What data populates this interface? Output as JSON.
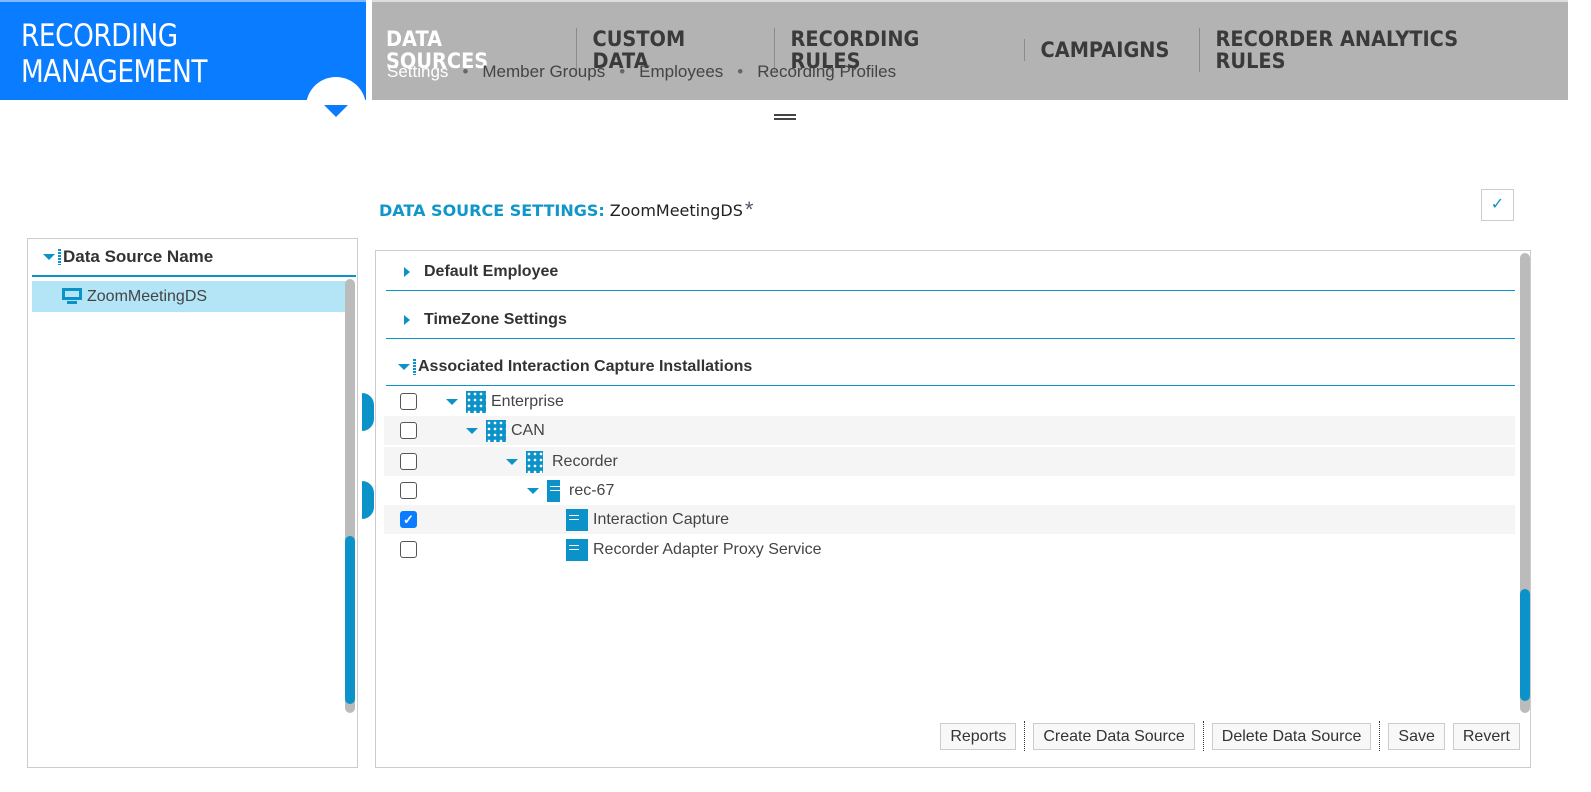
{
  "header": {
    "app_title": "RECORDING MANAGEMENT",
    "tabs": [
      {
        "label": "DATA SOURCES"
      },
      {
        "label": "CUSTOM DATA"
      },
      {
        "label": "RECORDING RULES"
      },
      {
        "label": "CAMPAIGNS"
      },
      {
        "label": "RECORDER ANALYTICS RULES"
      }
    ],
    "subtabs": [
      {
        "label": "Settings"
      },
      {
        "label": "Member Groups"
      },
      {
        "label": "Employees"
      },
      {
        "label": "Recording Profiles"
      }
    ]
  },
  "left_panel": {
    "column_header": "Data Source Name",
    "items": [
      {
        "label": "ZoomMeetingDS",
        "selected": true
      }
    ]
  },
  "main": {
    "title_label": "DATA SOURCE SETTINGS:",
    "title_value": "ZoomMeetingDS",
    "required_mark": "*",
    "confirm_icon": "✓",
    "sections": [
      {
        "label": "Default Employee"
      },
      {
        "label": "TimeZone Settings"
      },
      {
        "label": "Associated Interaction Capture Installations"
      }
    ],
    "tree": [
      {
        "label": "Enterprise",
        "checked": false,
        "icon": "enterprise-icon"
      },
      {
        "label": "CAN",
        "checked": false,
        "icon": "site-icon"
      },
      {
        "label": "Recorder",
        "checked": false,
        "icon": "building-icon"
      },
      {
        "label": "rec-67",
        "checked": false,
        "icon": "server-icon"
      },
      {
        "label": "Interaction Capture",
        "checked": true,
        "icon": "service-icon"
      },
      {
        "label": "Recorder Adapter Proxy Service",
        "checked": false,
        "icon": "service-icon"
      }
    ],
    "check_glyph": "✓",
    "buttons": {
      "reports": "Reports",
      "create": "Create Data Source",
      "delete": "Delete Data Source",
      "save": "Save",
      "revert": "Revert"
    }
  },
  "colors": {
    "brand": "#0a7cff",
    "accent": "#0b93c9",
    "nav": "#b3b3b3",
    "selected_row": "#b3e5f7"
  }
}
